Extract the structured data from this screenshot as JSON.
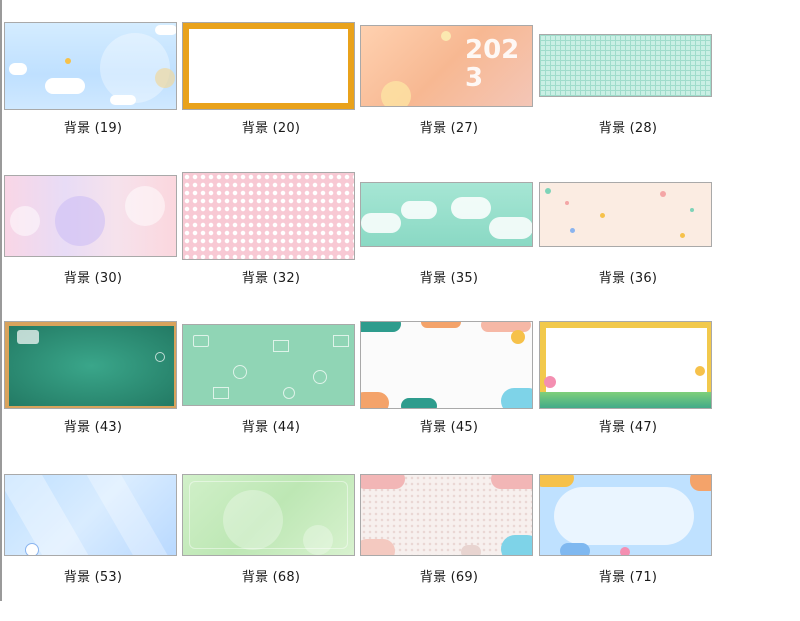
{
  "window": {
    "title": "背景"
  },
  "thumbnails": [
    {
      "label": "背景 (19)",
      "style": "sky"
    },
    {
      "label": "背景 (20)",
      "style": "orange-frame"
    },
    {
      "label": "背景 (27)",
      "style": "peach-2023",
      "text": "2023"
    },
    {
      "label": "背景 (28)",
      "style": "mint-grid"
    },
    {
      "label": "背景 (30)",
      "style": "pastel-bokeh"
    },
    {
      "label": "背景 (32)",
      "style": "pink-check"
    },
    {
      "label": "背景 (35)",
      "style": "mint-clouds"
    },
    {
      "label": "背景 (36)",
      "style": "cream-confetti"
    },
    {
      "label": "背景 (43)",
      "style": "chalkboard"
    },
    {
      "label": "背景 (44)",
      "style": "green-doodle"
    },
    {
      "label": "背景 (45)",
      "style": "white-blobs"
    },
    {
      "label": "背景 (47)",
      "style": "gold-frame"
    },
    {
      "label": "背景 (53)",
      "style": "blue-diagonal"
    },
    {
      "label": "背景 (68)",
      "style": "green-soft"
    },
    {
      "label": "背景 (69)",
      "style": "pink-dots"
    },
    {
      "label": "背景 (71)",
      "style": "blue-cloud-frame"
    }
  ],
  "colors": {
    "page_background": "#ffffff",
    "caption_text": "#1a1a1a",
    "thumb_border": "#a9a9a9"
  }
}
